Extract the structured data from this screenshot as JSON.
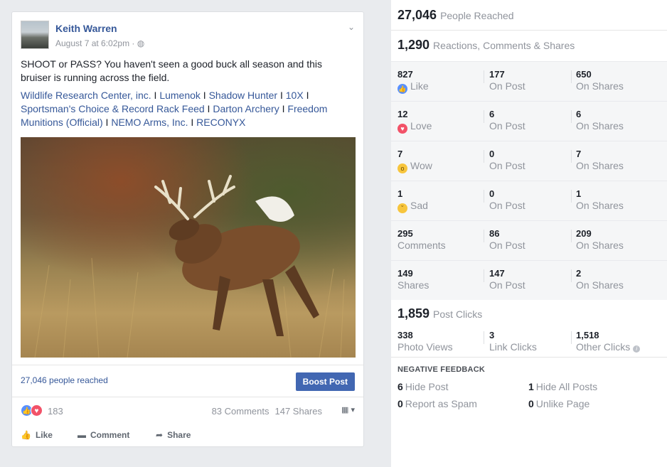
{
  "post": {
    "author": "Keith Warren",
    "date": "August 7 at 6:02pm",
    "text": "SHOOT or PASS? You haven't seen a good buck all season and this bruiser is running across the field.",
    "tags": [
      "Wildlife Research Center, inc.",
      "Lumenok",
      "Shadow Hunter",
      "10X",
      "Sportsman's Choice & Record Rack Feed",
      "Darton Archery",
      "Freedom Munitions (Official)",
      "NEMO Arms, Inc.",
      "RECONYX"
    ],
    "reach_text": "27,046 people reached",
    "boost_label": "Boost Post",
    "reaction_count": "183",
    "comments_count": "83 Comments",
    "shares_count": "147 Shares",
    "actions": {
      "like": "Like",
      "comment": "Comment",
      "share": "Share"
    }
  },
  "insights": {
    "people_reached": {
      "value": "27,046",
      "label": "People Reached"
    },
    "engagement": {
      "value": "1,290",
      "label": "Reactions, Comments & Shares"
    },
    "rows": [
      {
        "total": "827",
        "label": "Like",
        "emoji": "like-icon",
        "on_post": "177",
        "on_shares": "650"
      },
      {
        "total": "12",
        "label": "Love",
        "emoji": "love-icon",
        "on_post": "6",
        "on_shares": "6"
      },
      {
        "total": "7",
        "label": "Wow",
        "emoji": "wow-icon",
        "on_post": "0",
        "on_shares": "7"
      },
      {
        "total": "1",
        "label": "Sad",
        "emoji": "sad-icon",
        "on_post": "0",
        "on_shares": "1"
      },
      {
        "total": "295",
        "label": "Comments",
        "emoji": "",
        "on_post": "86",
        "on_shares": "209"
      },
      {
        "total": "149",
        "label": "Shares",
        "emoji": "",
        "on_post": "147",
        "on_shares": "2"
      }
    ],
    "on_post_label": "On Post",
    "on_shares_label": "On Shares",
    "post_clicks": {
      "value": "1,859",
      "label": "Post Clicks"
    },
    "clicks": [
      {
        "value": "338",
        "label": "Photo Views"
      },
      {
        "value": "3",
        "label": "Link Clicks"
      },
      {
        "value": "1,518",
        "label": "Other Clicks"
      }
    ],
    "negative_title": "NEGATIVE FEEDBACK",
    "negative": [
      {
        "value": "6",
        "label": "Hide Post"
      },
      {
        "value": "1",
        "label": "Hide All Posts"
      },
      {
        "value": "0",
        "label": "Report as Spam"
      },
      {
        "value": "0",
        "label": "Unlike Page"
      }
    ]
  },
  "colors": {
    "link": "#365899",
    "boost": "#4267b2",
    "like": "#5890ff",
    "love": "#f25268"
  }
}
